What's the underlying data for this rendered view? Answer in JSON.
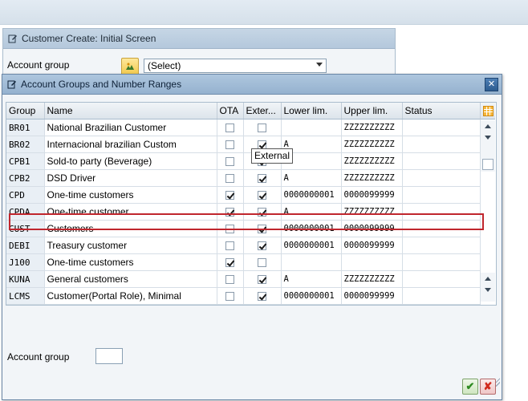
{
  "background_screen": {
    "title": "Customer Create: Initial Screen",
    "account_group_label": "Account group",
    "account_group_value": "(Select)"
  },
  "dialog": {
    "title": "Account Groups and Number Ranges",
    "close_glyph": "✕",
    "columns": [
      "Group",
      "Name",
      "OTA",
      "Exter...",
      "Lower lim.",
      "Upper lim.",
      "Status"
    ],
    "rows": [
      {
        "group": "BR01",
        "name": "National  Brazilian Customer",
        "ota": false,
        "external": false,
        "lower": "",
        "upper": "ZZZZZZZZZZ",
        "status": ""
      },
      {
        "group": "BR02",
        "name": "Internacional brazilian Custom",
        "ota": false,
        "external": true,
        "lower": "A",
        "upper": "ZZZZZZZZZZ",
        "status": ""
      },
      {
        "group": "CPB1",
        "name": "Sold-to party (Beverage)",
        "ota": false,
        "external": true,
        "lower": "A",
        "upper": "ZZZZZZZZZZ",
        "status": ""
      },
      {
        "group": "CPB2",
        "name": "DSD Driver",
        "ota": false,
        "external": true,
        "lower": "A",
        "upper": "ZZZZZZZZZZ",
        "status": ""
      },
      {
        "group": "CPD",
        "name": "One-time customers",
        "ota": true,
        "external": true,
        "lower": "0000000001",
        "upper": "0000099999",
        "status": ""
      },
      {
        "group": "CPDA",
        "name": "One-time customer",
        "ota": true,
        "external": true,
        "lower": "A",
        "upper": "ZZZZZZZZZZ",
        "status": ""
      },
      {
        "group": "CUST",
        "name": "Customers",
        "ota": false,
        "external": true,
        "lower": "0000000001",
        "upper": "0000099999",
        "status": ""
      },
      {
        "group": "DEBI",
        "name": "Treasury customer",
        "ota": false,
        "external": true,
        "lower": "0000000001",
        "upper": "0000099999",
        "status": ""
      },
      {
        "group": "J100",
        "name": "One-time customers",
        "ota": true,
        "external": false,
        "lower": "",
        "upper": "",
        "status": ""
      },
      {
        "group": "KUNA",
        "name": "General customers",
        "ota": false,
        "external": true,
        "lower": "A",
        "upper": "ZZZZZZZZZZ",
        "status": ""
      },
      {
        "group": "LCMS",
        "name": "Customer(Portal Role), Minimal",
        "ota": false,
        "external": true,
        "lower": "0000000001",
        "upper": "0000099999",
        "status": ""
      }
    ],
    "tooltip": "External",
    "account_group_label": "Account group",
    "account_group_value": "",
    "ok_glyph": "✔",
    "cancel_glyph": "✘"
  },
  "colors": {
    "highlight": "#c0262d",
    "title_bar": "#a8c1da",
    "confirm": "#2e8b22",
    "cancel": "#d12a1d"
  },
  "icons": [
    "edit-doc-icon",
    "value-help-icon",
    "dropdown-arrow-icon",
    "close-icon",
    "column-settings-icon",
    "scroll-up-icon",
    "scroll-down-icon",
    "confirm-check-icon",
    "cancel-x-icon"
  ]
}
